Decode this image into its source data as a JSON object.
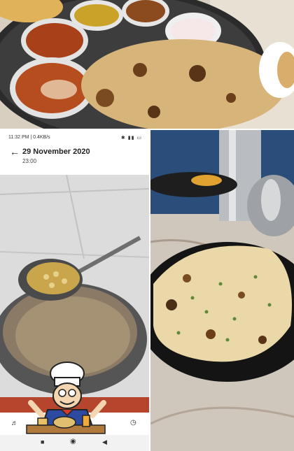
{
  "phone_status": {
    "time": "11:32 PM | 0.4KB/s",
    "icons": "✱ ▮▮ ▭"
  },
  "media_viewer": {
    "date": "29 November 2020",
    "time": "23:00"
  },
  "icons": {
    "back": "back-arrow-icon",
    "volume": "volume-icon",
    "timer": "timer-icon",
    "nav_home": "home-icon",
    "nav_back": "back-triangle-icon",
    "nav_recent": "recent-apps-icon"
  },
  "colors": {
    "plate": "#2e2e2e",
    "naan": "#d9b477",
    "curry": "#b3461c",
    "floor": "#dcdcdc",
    "table": "#d8cfc4"
  }
}
